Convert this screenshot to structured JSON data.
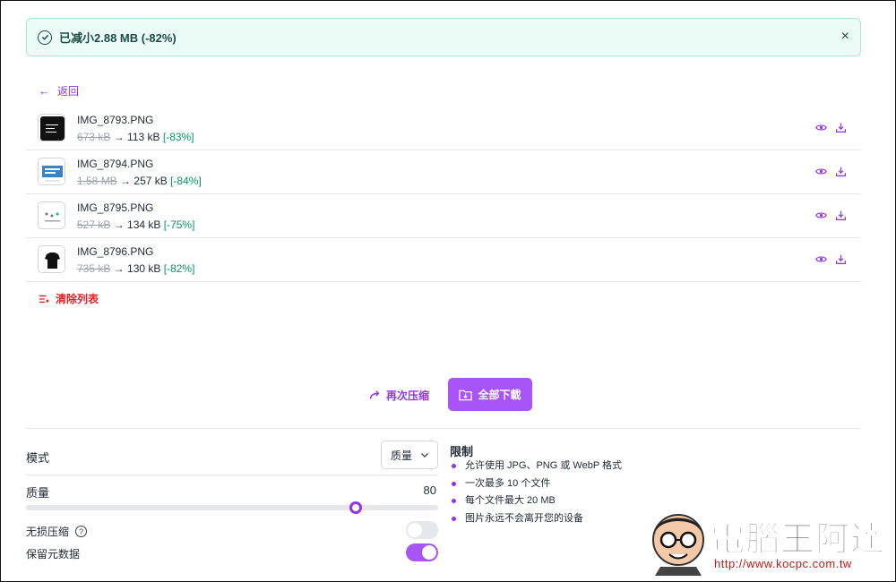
{
  "banner": {
    "message": "已减小2.88 MB (-82%)",
    "close": "×"
  },
  "nav": {
    "back_label": "返回"
  },
  "files": [
    {
      "name": "IMG_8793.PNG",
      "original": "673 kB",
      "arrow": "→",
      "compressed": "113 kB",
      "percent": "[-83%]"
    },
    {
      "name": "IMG_8794.PNG",
      "original": "1.58 MB",
      "arrow": "→",
      "compressed": "257 kB",
      "percent": "[-84%]"
    },
    {
      "name": "IMG_8795.PNG",
      "original": "527 kB",
      "arrow": "→",
      "compressed": "134 kB",
      "percent": "[-75%]"
    },
    {
      "name": "IMG_8796.PNG",
      "original": "735 kB",
      "arrow": "→",
      "compressed": "130 kB",
      "percent": "[-82%]"
    }
  ],
  "actions": {
    "clear_label": "清除列表",
    "recompress_label": "再次压缩",
    "download_all_label": "全部下載"
  },
  "settings": {
    "mode_label": "模式",
    "mode_value": "质量",
    "quality_label": "质量",
    "quality_value": "80",
    "quality_fraction": 0.8,
    "lossless_label": "无损压缩",
    "lossless_on": false,
    "metadata_label": "保留元数据",
    "metadata_on": true
  },
  "limits": {
    "title": "限制",
    "items": [
      "允许使用 JPG、PNG 或 WebP 格式",
      "一次最多 10 个文件",
      "每个文件最大 20 MB",
      "图片永远不会离开您的设备"
    ]
  },
  "watermark": {
    "title": "電腦王阿達",
    "url": "http://www.kocpc.com.tw"
  },
  "colors": {
    "accent": "#a855f7",
    "success": "#059669",
    "danger": "#dc2626"
  }
}
